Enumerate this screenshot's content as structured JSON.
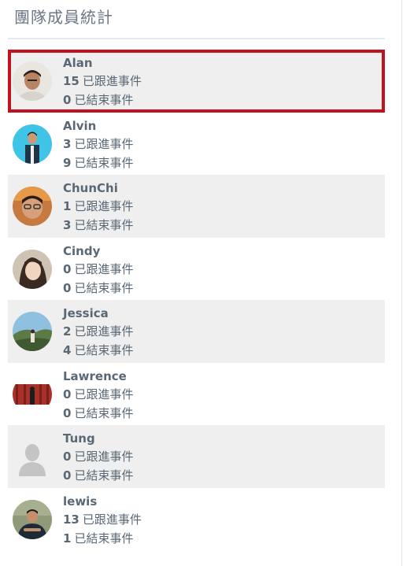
{
  "panel": {
    "title": "團隊成員統計"
  },
  "members": [
    {
      "name": "Alan",
      "following_count": "15",
      "following_label": "已跟進事件",
      "closed_count": "0",
      "closed_label": "已結束事件",
      "avatar": "photo-avatar"
    },
    {
      "name": "Alvin",
      "following_count": "3",
      "following_label": "已跟進事件",
      "closed_count": "9",
      "closed_label": "已結束事件",
      "avatar": "photo-avatar"
    },
    {
      "name": "ChunChi",
      "following_count": "1",
      "following_label": "已跟進事件",
      "closed_count": "3",
      "closed_label": "已結束事件",
      "avatar": "photo-avatar"
    },
    {
      "name": "Cindy",
      "following_count": "0",
      "following_label": "已跟進事件",
      "closed_count": "0",
      "closed_label": "已結束事件",
      "avatar": "photo-avatar"
    },
    {
      "name": "Jessica",
      "following_count": "2",
      "following_label": "已跟進事件",
      "closed_count": "4",
      "closed_label": "已結束事件",
      "avatar": "photo-avatar"
    },
    {
      "name": "Lawrence",
      "following_count": "0",
      "following_label": "已跟進事件",
      "closed_count": "0",
      "closed_label": "已結束事件",
      "avatar": "photo-avatar"
    },
    {
      "name": "Tung",
      "following_count": "0",
      "following_label": "已跟進事件",
      "closed_count": "0",
      "closed_label": "已結束事件",
      "avatar": "default-person-icon"
    },
    {
      "name": "lewis",
      "following_count": "13",
      "following_label": "已跟進事件",
      "closed_count": "1",
      "closed_label": "已結束事件",
      "avatar": "photo-avatar"
    }
  ],
  "colors": {
    "selection_outline": "#c1121f",
    "row_shade": "#efefef",
    "text": "#5a6876"
  }
}
